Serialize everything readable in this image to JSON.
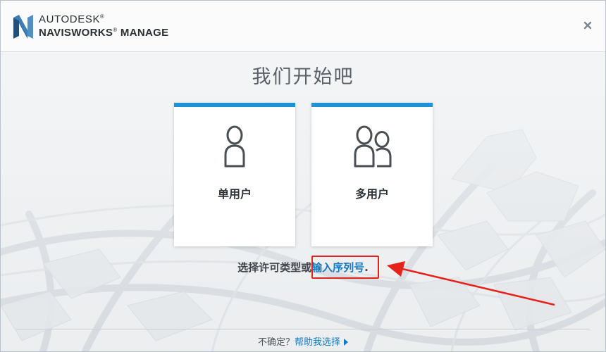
{
  "header": {
    "brand_line1": "AUTODESK",
    "brand_line1_mark": "®",
    "brand_line2": "NAVISWORKS",
    "brand_line2_mark": "®",
    "brand_line2_suffix": "MANAGE",
    "logo_icon": "navisworks-n-logo-icon",
    "close_icon": "close-icon"
  },
  "main": {
    "title": "我们开始吧",
    "cards": [
      {
        "label": "单用户",
        "icon": "single-user-icon"
      },
      {
        "label": "多用户",
        "icon": "multi-user-icon"
      }
    ],
    "prompt_lead": "选择许可类型或",
    "serial_link": "输入序列号",
    "prompt_end": "."
  },
  "footer": {
    "question": "不确定？",
    "help_link": "帮助我选择",
    "play_icon": "play-arrow-icon"
  },
  "colors": {
    "accent": "#1e92d3",
    "link": "#1479bf",
    "annotation": "#e5231a"
  }
}
